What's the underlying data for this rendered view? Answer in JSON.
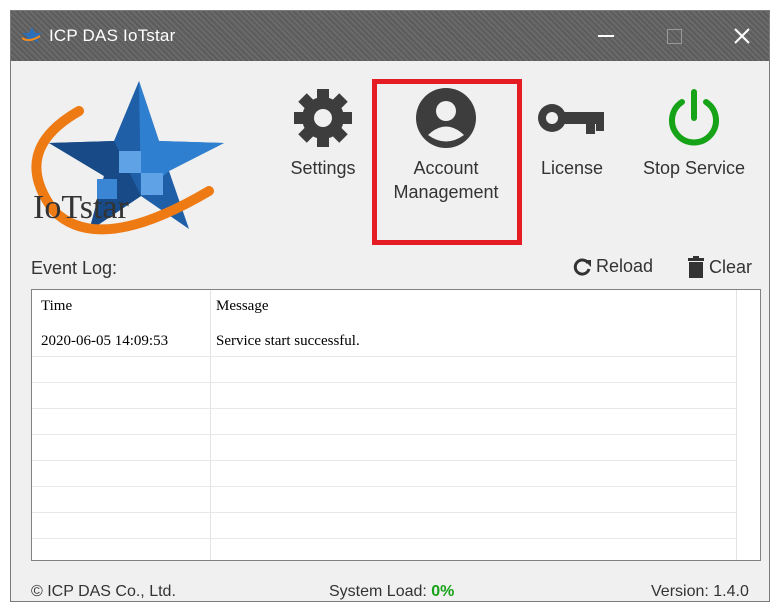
{
  "window": {
    "title": "ICP DAS IoTstar"
  },
  "logo": {
    "text": "IoTstar"
  },
  "toolbar": {
    "settings": "Settings",
    "account_line1": "Account",
    "account_line2": "Management",
    "license": "License",
    "stop": "Stop Service"
  },
  "event_log": {
    "label": "Event Log:",
    "reload": "Reload",
    "clear": "Clear",
    "columns": [
      "Time",
      "Message"
    ],
    "rows": [
      {
        "time": "2020-06-05 14:09:53",
        "message": "Service start successful."
      }
    ]
  },
  "status": {
    "copyright": "© ICP DAS Co., Ltd.",
    "load_label": "System Load:",
    "load_value": "0%",
    "version": "Version: 1.4.0"
  },
  "colors": {
    "highlight": "#e51c23",
    "stop_icon": "#17a317",
    "load_value": "#17a317"
  }
}
